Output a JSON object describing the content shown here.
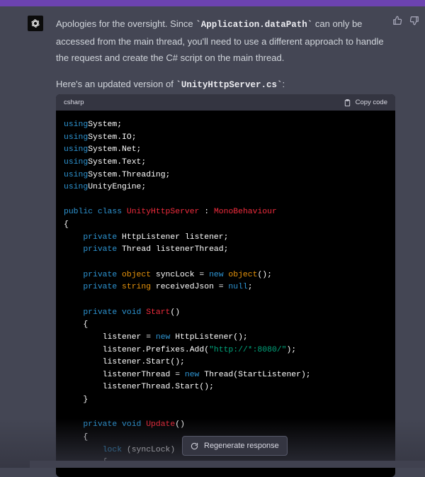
{
  "message": {
    "p1_part1": "Apologies for the oversight. Since ",
    "p1_code": "`Application.dataPath`",
    "p1_part2": " can only be accessed from the main thread, you'll need to use a different approach to handle the request and create the C# script on the main thread.",
    "p2_part1": "Here's an updated version of ",
    "p2_code": "`UnityHttpServer.cs`",
    "p2_part2": ":"
  },
  "code_block": {
    "language": "csharp",
    "copy_label": "Copy code",
    "lines": [
      [
        [
          "kw",
          "using"
        ],
        [
          "",
          "System;"
        ]
      ],
      [
        [
          "kw",
          "using"
        ],
        [
          "",
          "System.IO;"
        ]
      ],
      [
        [
          "kw",
          "using"
        ],
        [
          "",
          "System.Net;"
        ]
      ],
      [
        [
          "kw",
          "using"
        ],
        [
          "",
          "System.Text;"
        ]
      ],
      [
        [
          "kw",
          "using"
        ],
        [
          "",
          "System.Threading;"
        ]
      ],
      [
        [
          "kw",
          "using"
        ],
        [
          "",
          "UnityEngine;"
        ]
      ],
      [],
      [
        [
          "kw",
          "public class "
        ],
        [
          "ty",
          "UnityHttpServer"
        ],
        [
          "",
          " : "
        ],
        [
          "ty",
          "MonoBehaviour"
        ]
      ],
      [
        [
          "",
          "{"
        ]
      ],
      [
        [
          "",
          "    "
        ],
        [
          "kw",
          "private "
        ],
        [
          "",
          "HttpListener listener;"
        ]
      ],
      [
        [
          "",
          "    "
        ],
        [
          "kw",
          "private "
        ],
        [
          "",
          "Thread listenerThread;"
        ]
      ],
      [],
      [
        [
          "",
          "    "
        ],
        [
          "kw",
          "private "
        ],
        [
          "tp",
          "object"
        ],
        [
          "",
          " syncLock = "
        ],
        [
          "kw",
          "new "
        ],
        [
          "tp",
          "object"
        ],
        [
          "",
          "();"
        ]
      ],
      [
        [
          "",
          "    "
        ],
        [
          "kw",
          "private "
        ],
        [
          "tp",
          "string"
        ],
        [
          "",
          " receivedJson = "
        ],
        [
          "kw",
          "null"
        ],
        [
          "",
          ";"
        ]
      ],
      [],
      [
        [
          "",
          "    "
        ],
        [
          "kw",
          "private "
        ],
        [
          "kw",
          "void "
        ],
        [
          "ty",
          "Start"
        ],
        [
          "",
          "()"
        ]
      ],
      [
        [
          "",
          "    {"
        ]
      ],
      [
        [
          "",
          "        listener = "
        ],
        [
          "kw",
          "new "
        ],
        [
          "",
          "HttpListener();"
        ]
      ],
      [
        [
          "",
          "        listener.Prefixes.Add("
        ],
        [
          "str",
          "\"http://*:8080/\""
        ],
        [
          "",
          ");"
        ]
      ],
      [
        [
          "",
          "        listener.Start();"
        ]
      ],
      [
        [
          "",
          "        listenerThread = "
        ],
        [
          "kw",
          "new "
        ],
        [
          "",
          "Thread(StartListener);"
        ]
      ],
      [
        [
          "",
          "        listenerThread.Start();"
        ]
      ],
      [
        [
          "",
          "    }"
        ]
      ],
      [],
      [
        [
          "",
          "    "
        ],
        [
          "kw",
          "private "
        ],
        [
          "kw",
          "void "
        ],
        [
          "ty",
          "Update"
        ],
        [
          "",
          "()"
        ]
      ],
      [
        [
          "",
          "    {"
        ]
      ],
      [
        [
          "",
          "        "
        ],
        [
          "kw",
          "lock"
        ],
        [
          "",
          " (syncLock)"
        ]
      ],
      [
        [
          "",
          "        {"
        ]
      ]
    ]
  },
  "regenerate_label": "Regenerate response",
  "icons": {
    "avatar": "openai-logo-icon",
    "like": "thumbs-up-icon",
    "dislike": "thumbs-down-icon",
    "copy": "clipboard-icon",
    "regenerate": "refresh-icon"
  },
  "colors": {
    "page_bg": "#444654",
    "code_bg": "#000000",
    "code_header_bg": "#343541",
    "keyword": "#2e95d3",
    "class_name": "#f22c3d",
    "type": "#e9950c",
    "string": "#00a67d",
    "accent_bar": "#6c43b0"
  }
}
